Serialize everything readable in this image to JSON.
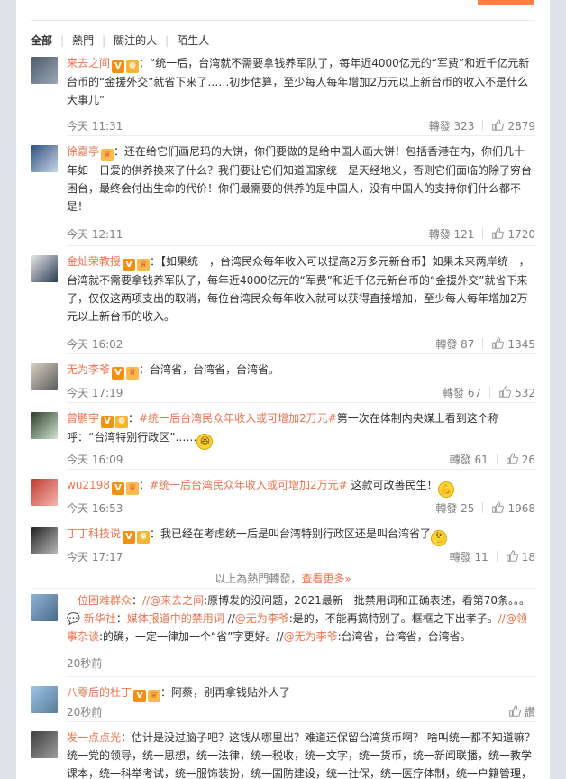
{
  "filters": {
    "all": "全部",
    "hot": "熱門",
    "following": "關注的人",
    "stranger": "陌生人"
  },
  "hot_comments": [
    {
      "user": "来去之间",
      "badges": [
        "v",
        "gift"
      ],
      "segments": [
        {
          "t": "：“统一后，台湾就不需要拿钱养军队了，每年近4000亿元的“军费”和近千亿元新台币的“金援外交”就省下来了……初步估算，至少每人每年增加2万元以上新台币的收入不是什么大事儿”"
        }
      ],
      "time": "今天 11:31",
      "repost": "轉發 323",
      "likes": "2879"
    },
    {
      "user": "徐嘉亭",
      "badges": [
        "lv"
      ],
      "segments": [
        {
          "t": "：还在给它们画尼玛的大饼，你们要做的是给中国人画大饼！包括香港在内，你们几十年如一日爱的供养换来了什么？我们要让它们知道国家统一是天经地义，否则它们面临的除了穷台困台，最终会付出生命的代价！你们最需要的供养的是中国人，没有中国人的支持你们什么都不是！"
        }
      ],
      "time": "今天 12:11",
      "repost": "轉發 121",
      "likes": "1720"
    },
    {
      "user": "金灿荣教授",
      "badges": [
        "v",
        "lv"
      ],
      "segments": [
        {
          "t": "：【如果统一，台湾民众每年收入可以提高2万多元新台币】如果未来两岸统一，台湾就不需要拿钱养军队了，每年近4000亿元的“军费”和近千亿元新台币的“金援外交”就省下来了，仅仅这两项支出的取消，每位台湾民众每年收入就可以获得直接增加，至少每人每年增加2万元以上新台币的收入。"
        }
      ],
      "time": "今天 16:02",
      "repost": "轉發 87",
      "likes": "1345"
    },
    {
      "user": "无为李爷",
      "badges": [
        "v",
        "lv"
      ],
      "segments": [
        {
          "t": "：台湾省，台湾省，台湾省。"
        }
      ],
      "time": "今天 17:19",
      "repost": "轉發 67",
      "likes": "532"
    },
    {
      "user": "曾鹏宇",
      "badges": [
        "v",
        "gift"
      ],
      "segments": [
        {
          "t": "："
        },
        {
          "t": "#统一后台湾民众年收入或可增加2万元#",
          "link": true
        },
        {
          "t": "第一次在体制内央媒上看到这个称呼：“台湾特别行政区”……"
        }
      ],
      "emoji_end": "laugh-emoji",
      "time": "今天 16:09",
      "repost": "轉發 61",
      "likes": "26"
    },
    {
      "user": "wu2198",
      "badges": [
        "v",
        "lv"
      ],
      "segments": [
        {
          "t": "："
        },
        {
          "t": "#统一后台湾民众年收入或可增加2万元#",
          "link": true
        },
        {
          "t": " 这款可改善民生！"
        }
      ],
      "emoji_end": "strong-emoji",
      "time": "今天 16:53",
      "repost": "轉發 25",
      "likes": "1968"
    },
    {
      "user": "丁丁科技说",
      "badges": [
        "v",
        "gift"
      ],
      "segments": [
        {
          "t": "：我已经在考虑统一后是叫台湾特别行政区还是叫台湾省了"
        }
      ],
      "emoji_end": "think-emoji",
      "time": "今天 17:17",
      "repost": "轉發 11",
      "likes": "18"
    }
  ],
  "more_row": {
    "text": "以上為熱門轉發，",
    "link": "查看更多»"
  },
  "recent": [
    {
      "user": "一位困难群众",
      "segments": [
        {
          "t": "："
        },
        {
          "t": "//@来去之间",
          "link": true
        },
        {
          "t": ":原博发的没问题，2021最新一批禁用词和正确表述，看第70条。。。"
        },
        {
          "t": "💬 新华社",
          "link": true
        },
        {
          "t": "："
        },
        {
          "t": "媒体报道中的禁用词",
          "link": true
        },
        {
          "t": " //"
        },
        {
          "t": "@无为李爷",
          "link": true
        },
        {
          "t": ":是的，不能再搞特别了。框框之下出孝子。"
        },
        {
          "t": "//@领事杂谈",
          "link": true
        },
        {
          "t": ":的确，一定一律加一个“省”字更好。//"
        },
        {
          "t": "@无为李爷",
          "link": true
        },
        {
          "t": ":台湾省，台湾省，台湾省。"
        }
      ],
      "time": "20秒前"
    },
    {
      "user": "八零后的杜丁",
      "badges": [
        "v",
        "lv"
      ],
      "segments": [
        {
          "t": "：阿蔡，别再拿钱贴外人了"
        }
      ],
      "time": "20秒前",
      "action": "讚"
    },
    {
      "user": "发一点点光",
      "segments": [
        {
          "t": "：估计是没过脑子吧？这钱从哪里出？难道还保留台湾货币啊？ 啥叫统一都不知道嘛？统一党的领导，统一思想，统一法律，统一税收，统一文字，统一货币，统一新闻联播，统一教学课本，统一科举考试，统一服饰装扮，统一国防建设，统一社保，统一医疗体制，统一户籍管理，统一军队编制"
        }
      ]
    }
  ],
  "colors": {
    "accent": "#eb7350",
    "orange_button": "#ff8140"
  }
}
